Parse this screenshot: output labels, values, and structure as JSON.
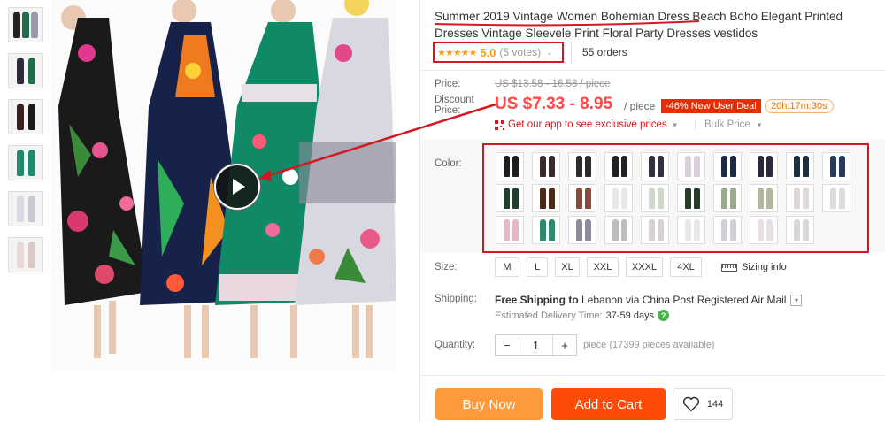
{
  "product": {
    "title": "Summer 2019 Vintage Women Bohemian Dress Beach Boho Elegant Printed Dresses Vintage Sleevele Print Floral Party Dresses vestidos",
    "stars": "★★★★★",
    "rating": "5.0",
    "votes": "(5 votes)",
    "orders": "55 orders"
  },
  "price": {
    "price_label": "Price:",
    "original": "US $13.58 - 16.58 / piece",
    "discount_label_1": "Discount",
    "discount_label_2": "Price:",
    "discount": "US $7.33 - 8.95",
    "per": "/ piece",
    "deal": "-46% New User Deal",
    "timer": "20h:17m:30s",
    "app_promo": "Get our app to see exclusive prices",
    "bulk": "Bulk Price"
  },
  "color": {
    "label": "Color:",
    "swatch_colors": [
      "#1e1e1e",
      "#3a2a2a",
      "#2b2b2b",
      "#222",
      "#303040",
      "#d9cfd9",
      "#1c2a4a",
      "#2a2a3a",
      "#1e2e3e",
      "#2a3a5a",
      "#1f3f2f",
      "#4a2a1a",
      "#8a4a3a",
      "#e8e8e8",
      "#cfd9c9",
      "#2a3a2a",
      "#9aaa8a",
      "#b0b8a0",
      "#e0d8d8",
      "#dcdcdc",
      "#e6b8c6",
      "#2c8a6a",
      "#8a8a9a",
      "#bcbcbc",
      "#d8d0d0",
      "#e8e8e8",
      "#d0d0d8",
      "#e8e0e0",
      "#d8d8d8"
    ]
  },
  "size": {
    "label": "Size:",
    "options": [
      "M",
      "L",
      "XL",
      "XXL",
      "XXXL",
      "4XL"
    ],
    "info": "Sizing info"
  },
  "shipping": {
    "label": "Shipping:",
    "text_bold": "Free Shipping to",
    "text_rest": " Lebanon via China Post Registered Air Mail",
    "est_label": "Estimated Delivery Time:",
    "est_days": "37-59 days"
  },
  "quantity": {
    "label": "Quantity:",
    "value": "1",
    "minus": "−",
    "plus": "+",
    "available": "piece (17399 pieces available)"
  },
  "actions": {
    "buy_now": "Buy Now",
    "add_to_cart": "Add to Cart",
    "wishlist_count": "144"
  },
  "colors": {
    "accent": "#ff4747",
    "annotation": "#d4181f",
    "star": "#ff9c1a",
    "buy": "#ff9a3c",
    "cart": "#ff4b0a"
  }
}
